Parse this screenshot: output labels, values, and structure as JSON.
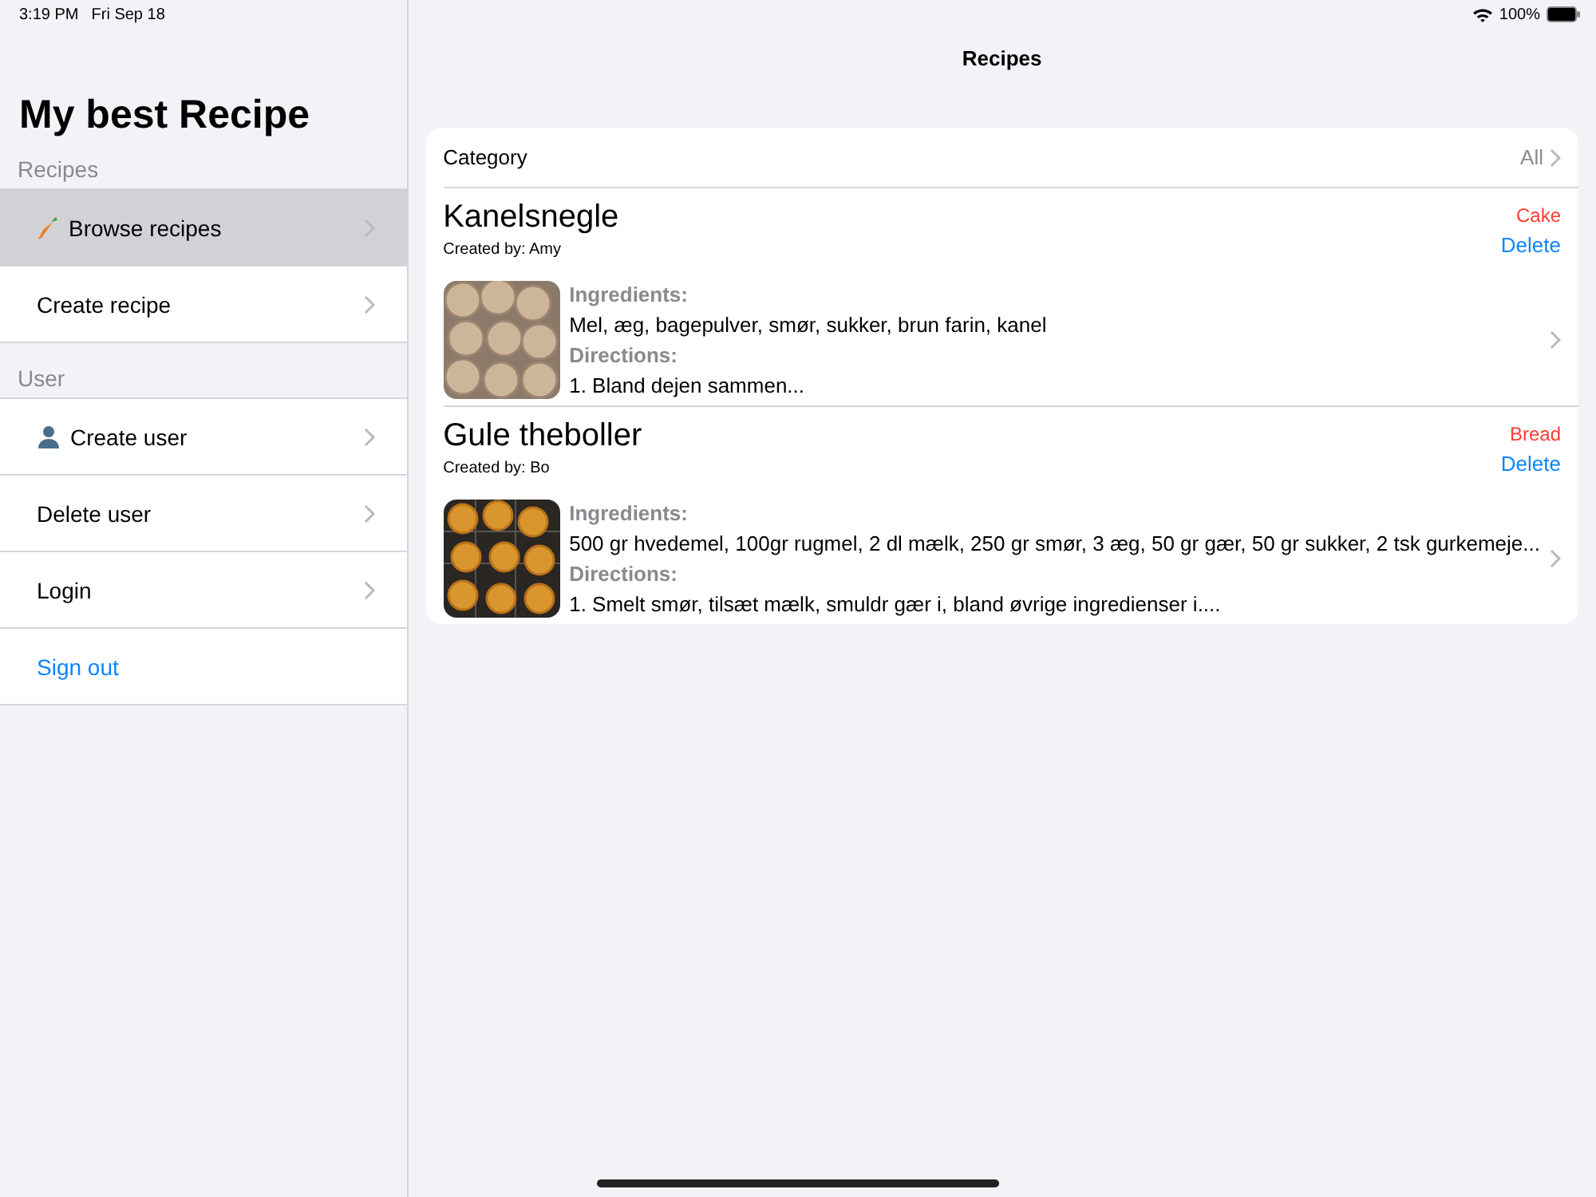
{
  "status_bar": {
    "time": "3:19 PM",
    "date": "Fri Sep 18",
    "battery": "100%"
  },
  "sidebar": {
    "title": "My best Recipe",
    "sections": [
      {
        "header": "Recipes",
        "items": [
          {
            "label": "Browse recipes",
            "kind": "carrot",
            "selected": true
          },
          {
            "label": "Create recipe",
            "kind": "plain",
            "selected": false
          }
        ]
      },
      {
        "header": "User",
        "items": [
          {
            "label": "Create user",
            "kind": "person",
            "selected": false
          },
          {
            "label": "Delete user",
            "kind": "plain",
            "selected": false
          },
          {
            "label": "Login",
            "kind": "plain",
            "selected": false
          },
          {
            "label": "Sign out",
            "kind": "link",
            "selected": false
          }
        ]
      }
    ]
  },
  "main": {
    "title": "Recipes",
    "filter": {
      "label": "Category",
      "value": "All"
    },
    "recipes": [
      {
        "name": "Kanelsnegle",
        "creator": "Created by: Amy",
        "category": "Cake",
        "delete": "Delete",
        "ingredients_label": "Ingredients:",
        "ingredients": "Mel, æg, bagepulver, smør, sukker, brun farin, kanel",
        "directions_label": "Directions:",
        "directions": "1. Bland dejen sammen..."
      },
      {
        "name": "Gule theboller",
        "creator": "Created by: Bo",
        "category": "Bread",
        "delete": "Delete",
        "ingredients_label": "Ingredients:",
        "ingredients": "500 gr hvedemel, 100gr rugmel, 2 dl mælk, 250 gr smør, 3 æg, 50 gr gær, 50 gr sukker, 2 tsk gurkemeje...",
        "directions_label": "Directions:",
        "directions": "1. Smelt smør, tilsæt mælk, smuldr gær i, bland øvrige ingredienser i...."
      }
    ]
  }
}
